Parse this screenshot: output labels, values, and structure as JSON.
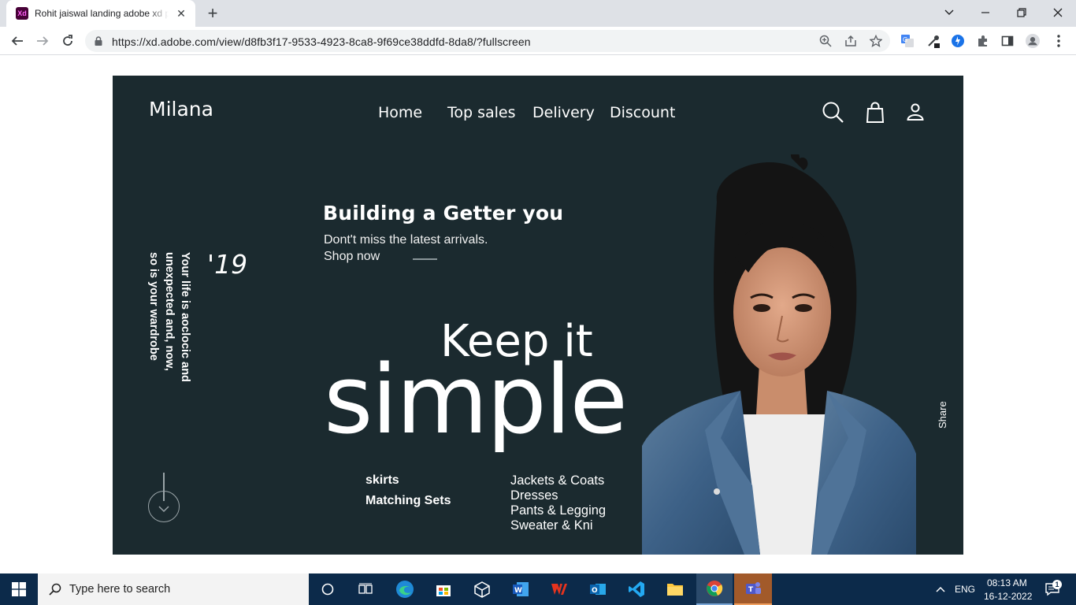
{
  "browser": {
    "tab_title": "Rohit jaiswal landing adobe xd p",
    "favicon_text": "Xd",
    "url": "https://xd.adobe.com/view/d8fb3f17-9533-4923-8ca8-9f69ce38ddfd-8da8/?fullscreen"
  },
  "page": {
    "brand": "Milana",
    "nav": [
      "Home",
      "Top sales",
      "Delivery",
      "Discount"
    ],
    "headline": "Building a Getter you",
    "subline1": "Dont't miss the latest arrivals.",
    "subline2": "Shop now",
    "keep": "Keep it",
    "simple": "simple",
    "vertical_lines": [
      "Your life is aoclocic and",
      "unexpected and, now,",
      "so is your wardrobe"
    ],
    "year": "'19",
    "categories_left": [
      "skirts",
      "Matching Sets"
    ],
    "categories_right": [
      "Jackets & Coats",
      "Dresses",
      "Pants & Legging",
      "Sweater & Kni"
    ],
    "share": "Share",
    "background_color": "#1b2a2f"
  },
  "taskbar": {
    "search_placeholder": "Type here to search",
    "language": "ENG",
    "time": "08:13 AM",
    "date": "16-12-2022",
    "notification_count": "1",
    "color": "#0c2a4a"
  }
}
